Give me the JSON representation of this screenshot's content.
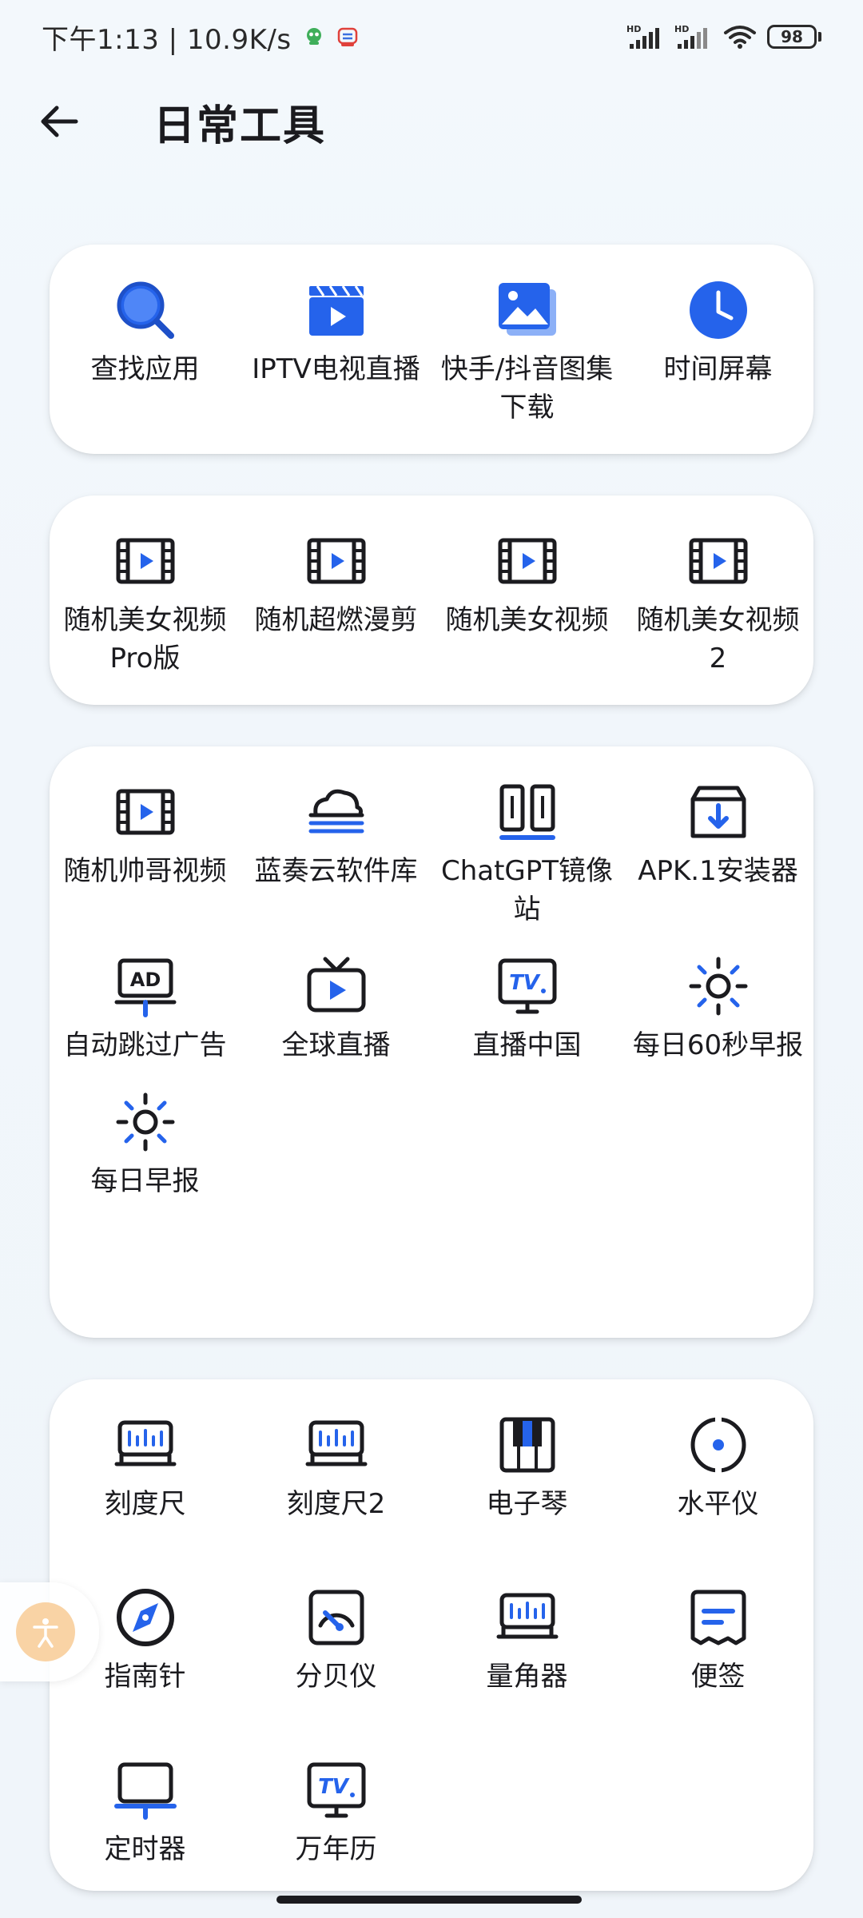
{
  "status_bar": {
    "time_speed": "下午1:13 | 10.9K/s",
    "battery": "98"
  },
  "header": {
    "title": "日常工具"
  },
  "colors": {
    "accent": "#2563eb",
    "dark": "#1b1b1f",
    "float_button": "#f9d3a5"
  },
  "groups": [
    {
      "tools": [
        {
          "label": "查找应用",
          "icon": "search-icon"
        },
        {
          "label": "IPTV电视直播",
          "icon": "clapperboard-icon"
        },
        {
          "label": "快手/抖音图集下载",
          "icon": "gallery-icon"
        },
        {
          "label": "时间屏幕",
          "icon": "clock-icon"
        }
      ]
    },
    {
      "tools": [
        {
          "label": "随机美女视频Pro版",
          "icon": "film-icon"
        },
        {
          "label": "随机超燃漫剪",
          "icon": "film-icon"
        },
        {
          "label": "随机美女视频",
          "icon": "film-icon"
        },
        {
          "label": "随机美女视频2",
          "icon": "film-icon"
        }
      ]
    },
    {
      "tools": [
        {
          "label": "随机帅哥视频",
          "icon": "film-icon"
        },
        {
          "label": "蓝奏云软件库",
          "icon": "cloud-icon"
        },
        {
          "label": "ChatGPT镜像站",
          "icon": "split-panel-icon"
        },
        {
          "label": "APK.1安装器",
          "icon": "download-box-icon"
        },
        {
          "label": "自动跳过广告",
          "icon": "ad-icon"
        },
        {
          "label": "全球直播",
          "icon": "tv-play-icon"
        },
        {
          "label": "直播中国",
          "icon": "tv-text-icon"
        },
        {
          "label": "每日60秒早报",
          "icon": "sun-icon"
        },
        {
          "label": "每日早报",
          "icon": "sun-icon"
        }
      ]
    },
    {
      "tools": [
        {
          "label": "刻度尺",
          "icon": "ruler-icon"
        },
        {
          "label": "刻度尺2",
          "icon": "ruler-icon"
        },
        {
          "label": "电子琴",
          "icon": "piano-icon"
        },
        {
          "label": "水平仪",
          "icon": "level-icon"
        },
        {
          "label": "指南针",
          "icon": "compass-icon"
        },
        {
          "label": "分贝仪",
          "icon": "gauge-icon"
        },
        {
          "label": "量角器",
          "icon": "protractor-icon"
        },
        {
          "label": "便签",
          "icon": "note-icon"
        },
        {
          "label": "定时器",
          "icon": "monitor-icon"
        },
        {
          "label": "万年历",
          "icon": "tv-text-icon"
        }
      ]
    }
  ]
}
